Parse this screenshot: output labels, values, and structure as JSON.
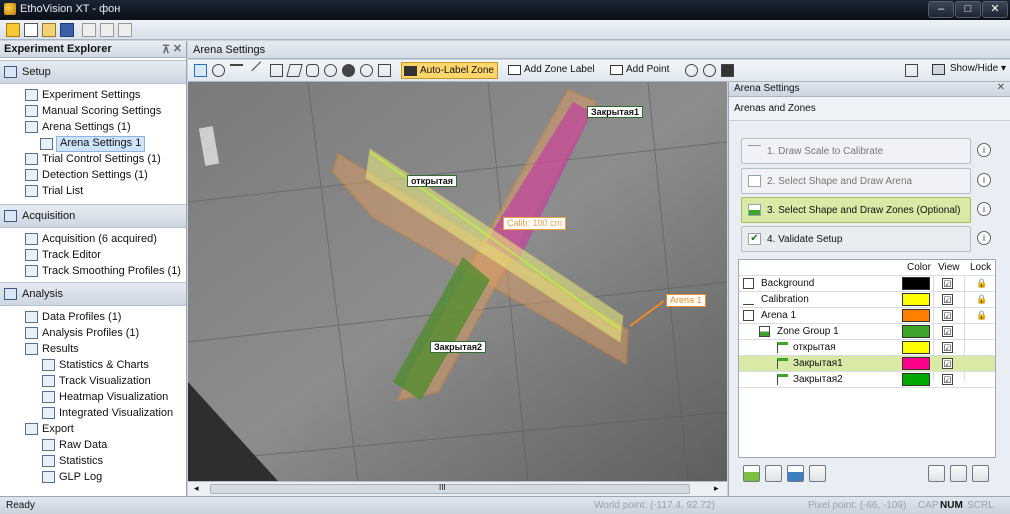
{
  "window": {
    "title": "EthoVision XT - фон",
    "controls": [
      "–",
      "□",
      "✕"
    ]
  },
  "explorer": {
    "title": "Experiment Explorer",
    "pin": "⊼",
    "close": "✕",
    "sections": [
      {
        "label": "Setup",
        "items": [
          {
            "label": "Experiment Settings",
            "icon": "settings-doc-icon"
          },
          {
            "label": "Manual Scoring Settings",
            "icon": "manual-scoring-icon"
          },
          {
            "label": "Arena Settings (1)",
            "icon": "arena-icon"
          },
          {
            "label": "Arena Settings 1",
            "icon": "arena-item-icon",
            "selected": true
          },
          {
            "label": "Trial Control Settings (1)",
            "icon": "trial-control-icon"
          },
          {
            "label": "Detection Settings (1)",
            "icon": "detection-icon"
          },
          {
            "label": "Trial List",
            "icon": "list-icon"
          }
        ]
      },
      {
        "label": "Acquisition",
        "items": [
          {
            "label": "Acquisition (6 acquired)",
            "icon": "acquisition-icon"
          },
          {
            "label": "Track Editor",
            "icon": "track-editor-icon"
          },
          {
            "label": "Track Smoothing Profiles (1)",
            "icon": "smoothing-icon"
          }
        ]
      },
      {
        "label": "Analysis",
        "items": [
          {
            "label": "Data Profiles (1)",
            "icon": "data-profile-icon"
          },
          {
            "label": "Analysis Profiles (1)",
            "icon": "analysis-profile-icon"
          },
          {
            "label": "Results",
            "icon": "results-icon"
          },
          {
            "label": "Statistics & Charts",
            "icon": "stats-chart-icon"
          },
          {
            "label": "Track Visualization",
            "icon": "track-vis-icon"
          },
          {
            "label": "Heatmap Visualization",
            "icon": "heatmap-icon"
          },
          {
            "label": "Integrated Visualization",
            "icon": "integrated-vis-icon"
          },
          {
            "label": "Export",
            "icon": "export-icon"
          },
          {
            "label": "Raw Data",
            "icon": "raw-data-icon"
          },
          {
            "label": "Statistics",
            "icon": "statistics-icon"
          },
          {
            "label": "GLP Log",
            "icon": "glp-log-icon"
          }
        ]
      }
    ]
  },
  "arena": {
    "header": "Arena Settings",
    "toolbar": {
      "auto_label": "Auto-Label Zone",
      "add_zone_label": "Add Zone Label",
      "add_point": "Add Point",
      "show_hide": "Show/Hide"
    },
    "canvas_labels": {
      "open_zone": "открытая",
      "closed1": "Закрытая1",
      "closed2": "Закрытая2",
      "arena": "Arena 1",
      "calib": "Calib: 100 cm"
    },
    "scroll_mark": "III"
  },
  "panel": {
    "title": "Arena Settings",
    "close": "✕",
    "subtitle": "Arenas and Zones",
    "steps": [
      {
        "label": "1. Draw Scale to Calibrate",
        "state": "disabled"
      },
      {
        "label": "2. Select Shape and Draw Arena",
        "state": "disabled"
      },
      {
        "label": "3. Select Shape and Draw Zones (Optional)",
        "state": "active"
      },
      {
        "label": "4. Validate Setup",
        "state": "done"
      }
    ],
    "info_glyph": "i",
    "table": {
      "headers": {
        "color": "Color",
        "view": "View",
        "lock": "Lock"
      },
      "rows": [
        {
          "name": "Background",
          "color": "#000000",
          "view": "☑",
          "lock": "🔒"
        },
        {
          "name": "Calibration",
          "color": "#ffff00",
          "view": "☑",
          "lock": "🔒"
        },
        {
          "name": "Arena 1",
          "color": "#ff8000",
          "view": "☑",
          "lock": "🔒"
        },
        {
          "name": "Zone Group 1",
          "color": "#3fa52a",
          "view": "☑",
          "lock": ""
        },
        {
          "name": "открытая",
          "color": "#ffff00",
          "view": "☑",
          "lock": ""
        },
        {
          "name": "Закрытая1",
          "color": "#ff0088",
          "view": "☑",
          "lock": ""
        },
        {
          "name": "Закрытая2",
          "color": "#00a800",
          "view": "☑",
          "lock": ""
        }
      ]
    }
  },
  "status": {
    "ready": "Ready",
    "world_point": "World point: (-117.4, 92.72)",
    "pixel_point": "Pixel point: (-66, -109)",
    "cap": "CAP",
    "num": "NUM",
    "scrl": "SCRL"
  }
}
